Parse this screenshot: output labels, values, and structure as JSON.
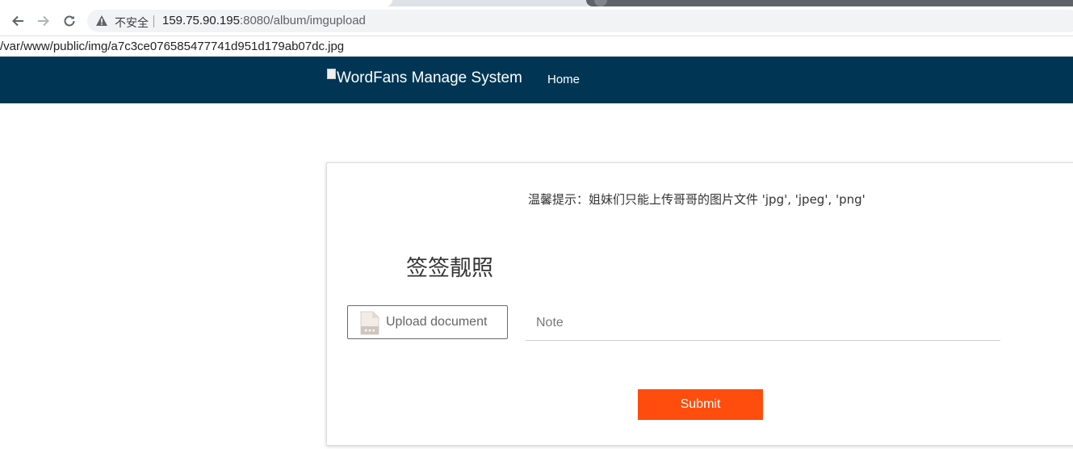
{
  "browser": {
    "security_label": "不安全",
    "url_host": "159.75.90.195",
    "url_path": ":8080/album/imgupload"
  },
  "debug_output": "/var/www/public/img/a7c3ce076585477741d951d179ab07dc.jpg",
  "navbar": {
    "brand_img_alt": "Word",
    "brand_text": "Fans Manage System",
    "home_link": "Home",
    "background": "#003654"
  },
  "form": {
    "tip": "温馨提示：姐妹们只能上传哥哥的图片文件 'jpg', 'jpeg', 'png'",
    "title": "签签靓照",
    "upload_label": "Upload document",
    "note_placeholder": "Note",
    "note_value": "",
    "submit_label": "Submit",
    "submit_color": "#ff4d0d"
  }
}
